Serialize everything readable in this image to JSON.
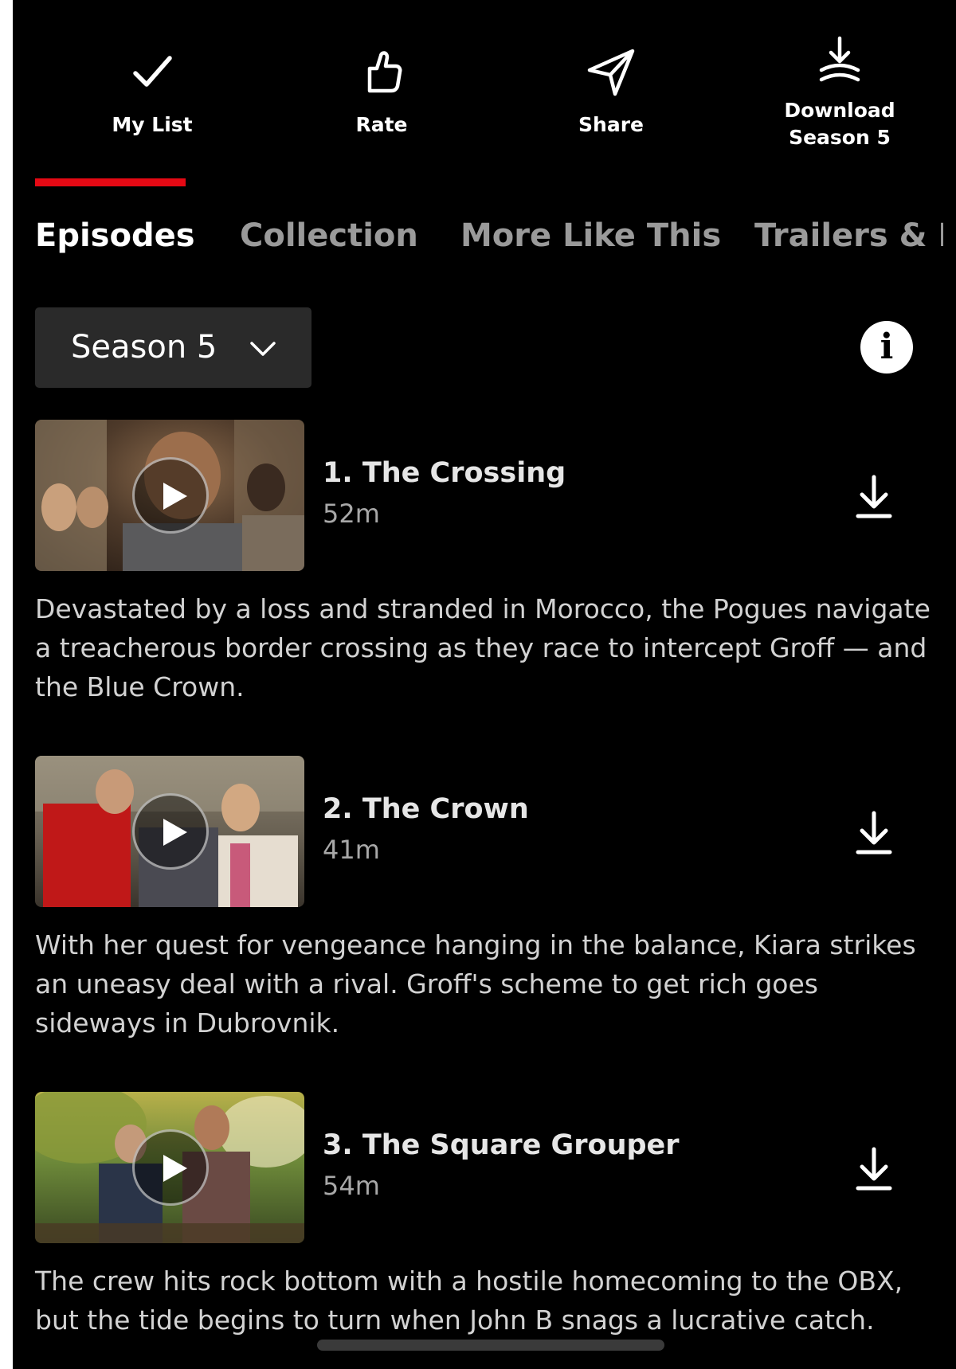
{
  "actions": {
    "my_list": "My List",
    "rate": "Rate",
    "share": "Share",
    "download_line1": "Download",
    "download_line2": "Season 5"
  },
  "tabs": [
    "Episodes",
    "Collection",
    "More Like This",
    "Trailers & M"
  ],
  "active_tab": "Episodes",
  "season_selector": "Season 5",
  "info_icon": "i",
  "episodes": [
    {
      "title": "1. The Crossing",
      "duration": "52m",
      "description": "Devastated by a loss and stranded in Morocco, the Pogues navigate a treacherous border crossing as they race to intercept Groff — and the Blue Crown."
    },
    {
      "title": "2. The Crown",
      "duration": "41m",
      "description": "With her quest for vengeance hanging in the balance, Kiara strikes an uneasy deal with a rival. Groff's scheme to get rich goes sideways in Dubrovnik."
    },
    {
      "title": "3. The Square Grouper",
      "duration": "54m",
      "description": "The crew hits rock bottom with a hostile homecoming to the OBX, but the tide begins to turn when John B snags a lucrative catch."
    }
  ],
  "colors": {
    "background": "#000000",
    "accent": "#e50914",
    "inactive_tab": "#9a9a9a",
    "selector_bg": "#2a2a2a"
  },
  "icons": [
    "check-icon",
    "thumbs-up-icon",
    "send-icon",
    "download-season-icon",
    "chevron-down-icon",
    "info-icon",
    "play-icon",
    "download-icon"
  ]
}
